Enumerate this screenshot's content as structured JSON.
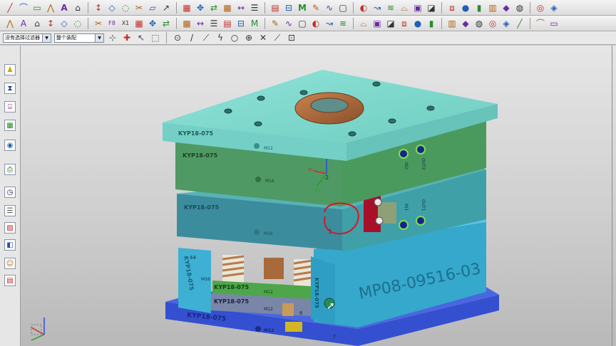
{
  "toolbar_row1_icons": [
    "line-icon",
    "arc-icon",
    "rectangle-icon",
    "polyline-icon",
    "text-icon",
    "note-icon",
    "dimension-icon",
    "chamfer-icon",
    "fillet-icon",
    "trim-icon",
    "surface-icon",
    "select-icon",
    "grid-icon",
    "snap-icon",
    "mirror-icon",
    "pattern-icon",
    "measure-icon",
    "layer-icon",
    "table-icon",
    "section-icon",
    "m-icon",
    "annotate-icon",
    "curve-icon",
    "extrude-icon",
    "revolve-icon",
    "sweep-icon",
    "loft-icon",
    "blend-icon",
    "shell-icon",
    "draft-icon",
    "offset-icon",
    "hole-icon",
    "boss-icon",
    "rib-icon",
    "split-icon",
    "unite-icon",
    "subtract-icon",
    "intersect-icon"
  ],
  "toolbar_row2_icons": [
    "wcs-icon",
    "triad-icon",
    "plane-icon",
    "datum-icon",
    "point-icon",
    "axis-icon",
    "csys-icon",
    "f8-icon",
    "x1-icon",
    "layout-icon",
    "view-icon",
    "fit-icon",
    "zoom-icon",
    "pan-icon",
    "rotate-icon",
    "render-icon",
    "shaded-icon",
    "wire-icon",
    "hidden-icon",
    "front-icon",
    "top-icon",
    "right-icon",
    "iso-icon",
    "cut-icon",
    "clip-icon",
    "close-icon",
    "move-icon",
    "color-icon",
    "block-icon",
    "cube-icon",
    "cylinder-icon",
    "cone-icon",
    "sphere-icon",
    "box-icon",
    "material-icon",
    "texture-icon",
    "light-icon",
    "camera-icon"
  ],
  "toolbar": {
    "f8_label": "F8",
    "x1_label": "X1",
    "text_tool_label": "A",
    "m_tool_label": "M"
  },
  "filter_bar": {
    "type_filter": "没有选择过滤器",
    "assembly_filter": "整个装配"
  },
  "mold": {
    "clamp_top_label": "KYP18-075",
    "top_plate_label": "KYP18-075",
    "a_plate_label": "KYP18-075",
    "bottom_clamp_label": "KYP18-075",
    "spacer_left_label": "KYP18-075",
    "spacer_right_label": "KYP18-075",
    "ejector_top_label": "KYP18-075",
    "ejector_bottom_label": "KYP18-075",
    "part_number": "MP08-09516-03",
    "m12_a": "M12",
    "m12_b": "M12",
    "m12_c": "M12",
    "m12_d": "M12",
    "m16_a": "M16",
    "m16_b": "M16",
    "m16_c": "M16",
    "in2": "IN2",
    "out2": "OUT2",
    "in1": "IN1",
    "out1": "OUT1",
    "num_1": "1",
    "num_2": "2",
    "num_3": "3",
    "num_4": "4",
    "num_5": "5",
    "num_6": "6",
    "num_7": "7",
    "num_44": "44",
    "zc": "ZC",
    "yc": "YC",
    "xc": "XC"
  },
  "colors": {
    "top_clamp": "#7fd8cc",
    "plate_a": "#4f9a64",
    "plate_b": "#3e8fa0",
    "lower_cyan": "#3ab3d4",
    "base": "#3a52d6",
    "ring": "#b06a3c",
    "annotation": "#e0101e"
  }
}
